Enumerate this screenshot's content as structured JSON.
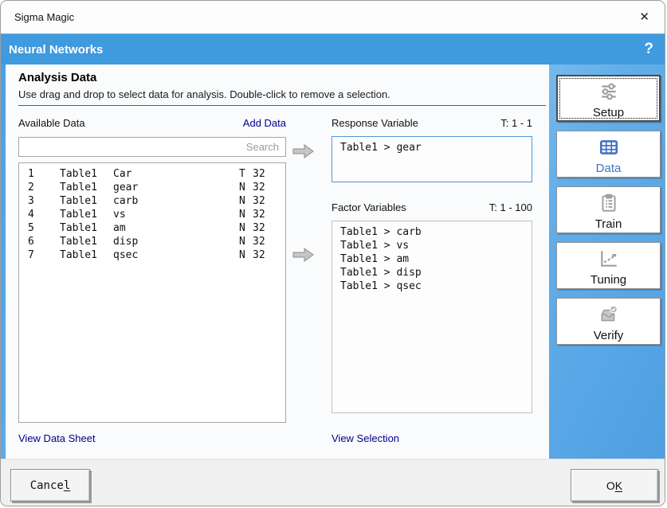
{
  "window": {
    "title": "Sigma Magic",
    "close_glyph": "✕"
  },
  "header": {
    "title": "Neural Networks",
    "help_glyph": "?"
  },
  "panel": {
    "title": "Analysis Data",
    "subtitle": "Use drag and drop to select data for analysis. Double-click to remove a selection.",
    "available": {
      "label": "Available Data",
      "add_link": "Add Data",
      "search_placeholder": "Search",
      "rows": [
        {
          "idx": "1",
          "table": "Table1",
          "name": "Car",
          "type": "T",
          "size": "32"
        },
        {
          "idx": "2",
          "table": "Table1",
          "name": "gear",
          "type": "N",
          "size": "32"
        },
        {
          "idx": "3",
          "table": "Table1",
          "name": "carb",
          "type": "N",
          "size": "32"
        },
        {
          "idx": "4",
          "table": "Table1",
          "name": "vs",
          "type": "N",
          "size": "32"
        },
        {
          "idx": "5",
          "table": "Table1",
          "name": "am",
          "type": "N",
          "size": "32"
        },
        {
          "idx": "6",
          "table": "Table1",
          "name": "disp",
          "type": "N",
          "size": "32"
        },
        {
          "idx": "7",
          "table": "Table1",
          "name": "qsec",
          "type": "N",
          "size": "32"
        }
      ],
      "view_link": "View Data Sheet"
    },
    "response": {
      "label": "Response Variable",
      "range": "T: 1 - 1",
      "items": [
        "Table1 > gear"
      ]
    },
    "factors": {
      "label": "Factor Variables",
      "range": "T: 1 - 100",
      "items": [
        "Table1 > carb",
        "Table1 > vs",
        "Table1 > am",
        "Table1 > disp",
        "Table1 > qsec"
      ],
      "view_link": "View Selection"
    }
  },
  "sidebar": {
    "items": [
      {
        "label": "Setup",
        "icon": "sliders-icon",
        "state": "focused"
      },
      {
        "label": "Data",
        "icon": "table-icon",
        "state": "active"
      },
      {
        "label": "Train",
        "icon": "clipboard-icon",
        "state": "normal"
      },
      {
        "label": "Tuning",
        "icon": "tuning-chart-icon",
        "state": "normal"
      },
      {
        "label": "Verify",
        "icon": "verify-tray-icon",
        "state": "normal"
      }
    ]
  },
  "footer": {
    "cancel_label": "Cancel",
    "cancel_mnemonic": "l",
    "ok_label": "OK",
    "ok_mnemonic": "K"
  },
  "colors": {
    "header_blue": "#3f9ade",
    "sidebar_blue": "#5fade9",
    "link_navy": "#00008b",
    "active_item_blue": "#4472c4",
    "response_box_border": "#4f96d8"
  }
}
